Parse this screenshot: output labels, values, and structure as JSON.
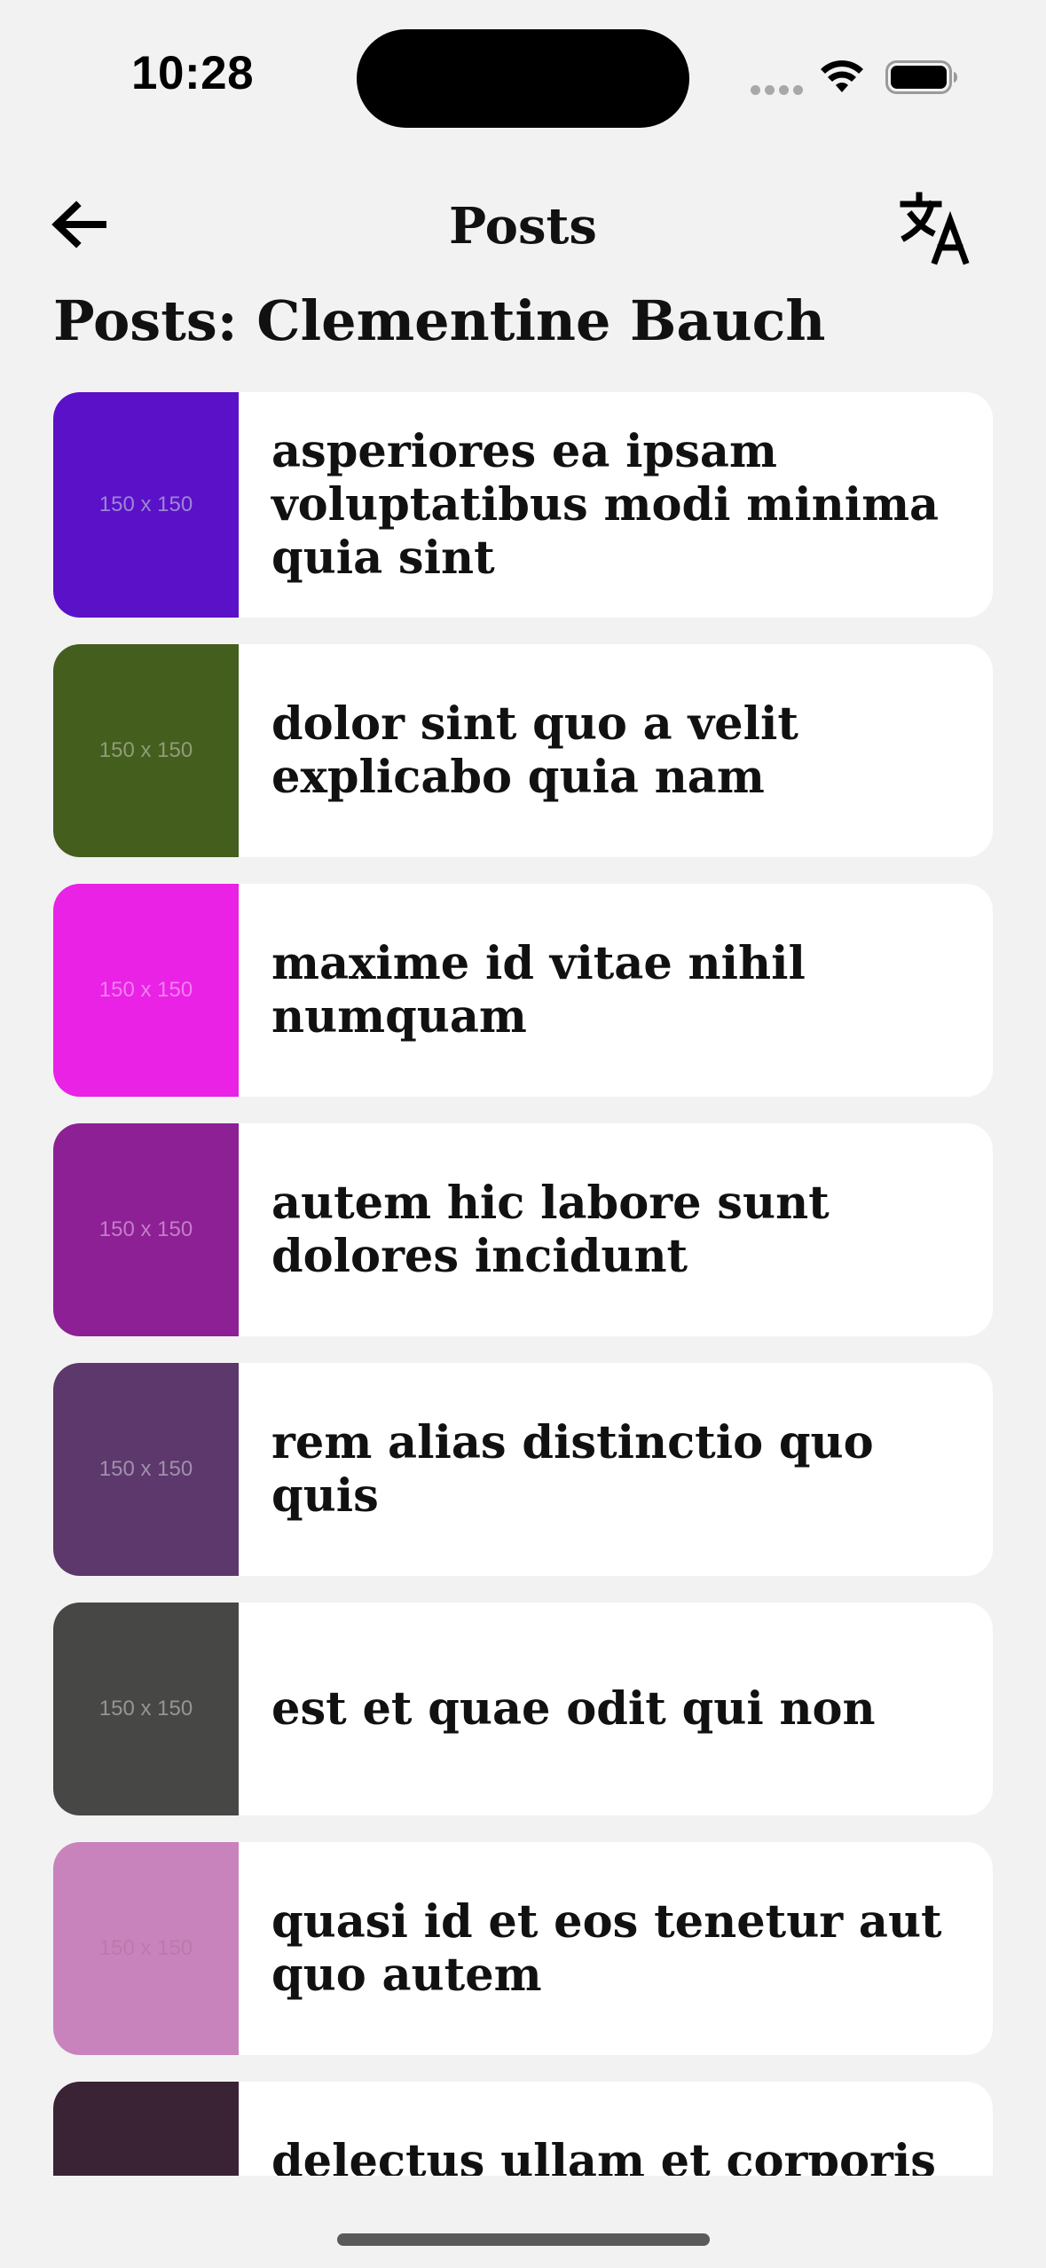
{
  "status_bar": {
    "time": "10:28",
    "icons": [
      "cellular-icon",
      "wifi-icon",
      "battery-icon"
    ]
  },
  "nav": {
    "title": "Posts",
    "back_icon": "arrow-left-icon",
    "translate_icon": "translate-icon"
  },
  "page": {
    "heading": "Posts: Clementine Bauch"
  },
  "thumb_placeholder": "150 x 150",
  "posts": [
    {
      "title": "asperiores ea ipsam voluptatibus modi minima quia sint",
      "color": "#5b11c8",
      "label_color": "#9c86d6"
    },
    {
      "title": "dolor sint quo a velit explicabo quia nam",
      "color": "#445e1e",
      "label_color": "#8f9d78"
    },
    {
      "title": "maxime id vitae nihil numquam",
      "color": "#e922e5",
      "label_color": "#f37ff0"
    },
    {
      "title": "autem hic labore sunt dolores incidunt",
      "color": "#8c2094",
      "label_color": "#c47ec8"
    },
    {
      "title": "rem alias distinctio quo quis",
      "color": "#5c386c",
      "label_color": "#a28fab"
    },
    {
      "title": "est et quae odit qui non",
      "color": "#474746",
      "label_color": "#959594"
    },
    {
      "title": "quasi id et eos tenetur aut quo autem",
      "color": "#c983bc",
      "label_color": "#b97aad"
    },
    {
      "title": "delectus ullam et corporis nulla",
      "color": "#3a2335",
      "label_color": "#8c7c88"
    }
  ]
}
